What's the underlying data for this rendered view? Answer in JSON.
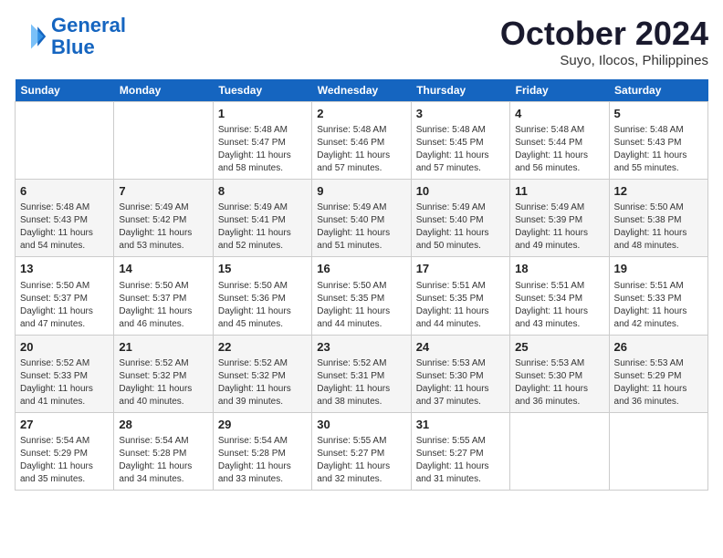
{
  "header": {
    "logo_line1": "General",
    "logo_line2": "Blue",
    "month_title": "October 2024",
    "location": "Suyo, Ilocos, Philippines"
  },
  "days_of_week": [
    "Sunday",
    "Monday",
    "Tuesday",
    "Wednesday",
    "Thursday",
    "Friday",
    "Saturday"
  ],
  "weeks": [
    [
      {
        "day": "",
        "info": ""
      },
      {
        "day": "",
        "info": ""
      },
      {
        "day": "1",
        "info": "Sunrise: 5:48 AM\nSunset: 5:47 PM\nDaylight: 11 hours and 58 minutes."
      },
      {
        "day": "2",
        "info": "Sunrise: 5:48 AM\nSunset: 5:46 PM\nDaylight: 11 hours and 57 minutes."
      },
      {
        "day": "3",
        "info": "Sunrise: 5:48 AM\nSunset: 5:45 PM\nDaylight: 11 hours and 57 minutes."
      },
      {
        "day": "4",
        "info": "Sunrise: 5:48 AM\nSunset: 5:44 PM\nDaylight: 11 hours and 56 minutes."
      },
      {
        "day": "5",
        "info": "Sunrise: 5:48 AM\nSunset: 5:43 PM\nDaylight: 11 hours and 55 minutes."
      }
    ],
    [
      {
        "day": "6",
        "info": "Sunrise: 5:48 AM\nSunset: 5:43 PM\nDaylight: 11 hours and 54 minutes."
      },
      {
        "day": "7",
        "info": "Sunrise: 5:49 AM\nSunset: 5:42 PM\nDaylight: 11 hours and 53 minutes."
      },
      {
        "day": "8",
        "info": "Sunrise: 5:49 AM\nSunset: 5:41 PM\nDaylight: 11 hours and 52 minutes."
      },
      {
        "day": "9",
        "info": "Sunrise: 5:49 AM\nSunset: 5:40 PM\nDaylight: 11 hours and 51 minutes."
      },
      {
        "day": "10",
        "info": "Sunrise: 5:49 AM\nSunset: 5:40 PM\nDaylight: 11 hours and 50 minutes."
      },
      {
        "day": "11",
        "info": "Sunrise: 5:49 AM\nSunset: 5:39 PM\nDaylight: 11 hours and 49 minutes."
      },
      {
        "day": "12",
        "info": "Sunrise: 5:50 AM\nSunset: 5:38 PM\nDaylight: 11 hours and 48 minutes."
      }
    ],
    [
      {
        "day": "13",
        "info": "Sunrise: 5:50 AM\nSunset: 5:37 PM\nDaylight: 11 hours and 47 minutes."
      },
      {
        "day": "14",
        "info": "Sunrise: 5:50 AM\nSunset: 5:37 PM\nDaylight: 11 hours and 46 minutes."
      },
      {
        "day": "15",
        "info": "Sunrise: 5:50 AM\nSunset: 5:36 PM\nDaylight: 11 hours and 45 minutes."
      },
      {
        "day": "16",
        "info": "Sunrise: 5:50 AM\nSunset: 5:35 PM\nDaylight: 11 hours and 44 minutes."
      },
      {
        "day": "17",
        "info": "Sunrise: 5:51 AM\nSunset: 5:35 PM\nDaylight: 11 hours and 44 minutes."
      },
      {
        "day": "18",
        "info": "Sunrise: 5:51 AM\nSunset: 5:34 PM\nDaylight: 11 hours and 43 minutes."
      },
      {
        "day": "19",
        "info": "Sunrise: 5:51 AM\nSunset: 5:33 PM\nDaylight: 11 hours and 42 minutes."
      }
    ],
    [
      {
        "day": "20",
        "info": "Sunrise: 5:52 AM\nSunset: 5:33 PM\nDaylight: 11 hours and 41 minutes."
      },
      {
        "day": "21",
        "info": "Sunrise: 5:52 AM\nSunset: 5:32 PM\nDaylight: 11 hours and 40 minutes."
      },
      {
        "day": "22",
        "info": "Sunrise: 5:52 AM\nSunset: 5:32 PM\nDaylight: 11 hours and 39 minutes."
      },
      {
        "day": "23",
        "info": "Sunrise: 5:52 AM\nSunset: 5:31 PM\nDaylight: 11 hours and 38 minutes."
      },
      {
        "day": "24",
        "info": "Sunrise: 5:53 AM\nSunset: 5:30 PM\nDaylight: 11 hours and 37 minutes."
      },
      {
        "day": "25",
        "info": "Sunrise: 5:53 AM\nSunset: 5:30 PM\nDaylight: 11 hours and 36 minutes."
      },
      {
        "day": "26",
        "info": "Sunrise: 5:53 AM\nSunset: 5:29 PM\nDaylight: 11 hours and 36 minutes."
      }
    ],
    [
      {
        "day": "27",
        "info": "Sunrise: 5:54 AM\nSunset: 5:29 PM\nDaylight: 11 hours and 35 minutes."
      },
      {
        "day": "28",
        "info": "Sunrise: 5:54 AM\nSunset: 5:28 PM\nDaylight: 11 hours and 34 minutes."
      },
      {
        "day": "29",
        "info": "Sunrise: 5:54 AM\nSunset: 5:28 PM\nDaylight: 11 hours and 33 minutes."
      },
      {
        "day": "30",
        "info": "Sunrise: 5:55 AM\nSunset: 5:27 PM\nDaylight: 11 hours and 32 minutes."
      },
      {
        "day": "31",
        "info": "Sunrise: 5:55 AM\nSunset: 5:27 PM\nDaylight: 11 hours and 31 minutes."
      },
      {
        "day": "",
        "info": ""
      },
      {
        "day": "",
        "info": ""
      }
    ]
  ]
}
